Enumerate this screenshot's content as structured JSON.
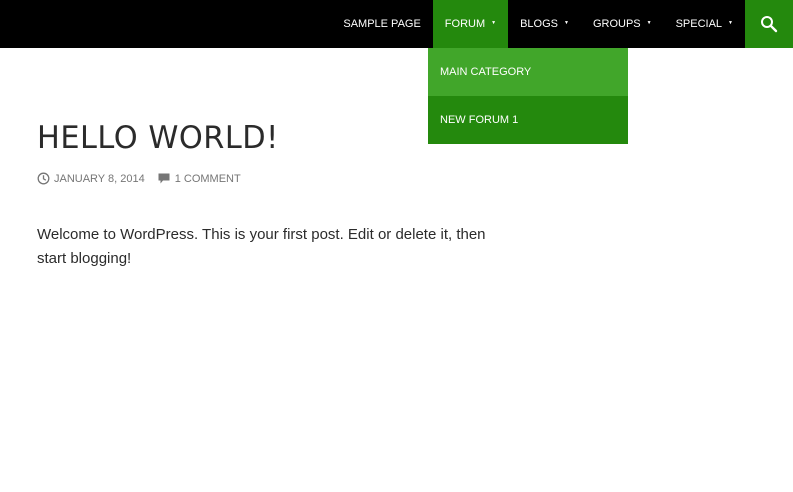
{
  "header": {
    "nav": [
      {
        "label": "Sample Page",
        "has_children": false,
        "active": false
      },
      {
        "label": "Forum",
        "has_children": true,
        "active": true
      },
      {
        "label": "Blogs",
        "has_children": true,
        "active": false
      },
      {
        "label": "Groups",
        "has_children": true,
        "active": false
      },
      {
        "label": "Special",
        "has_children": true,
        "active": false
      }
    ],
    "search_icon": "search-icon"
  },
  "submenu": {
    "items": [
      {
        "label": "Main Category"
      },
      {
        "label": "New Forum 1"
      }
    ]
  },
  "post": {
    "title": "Hello World!",
    "date": "January 8, 2014",
    "comments": "1 Comment",
    "body": "Welcome to WordPress. This is your first post. Edit or delete it, then start blogging!"
  },
  "colors": {
    "topbar": "#000000",
    "accent": "#24890d",
    "submenu_hover": "#41a62a"
  }
}
